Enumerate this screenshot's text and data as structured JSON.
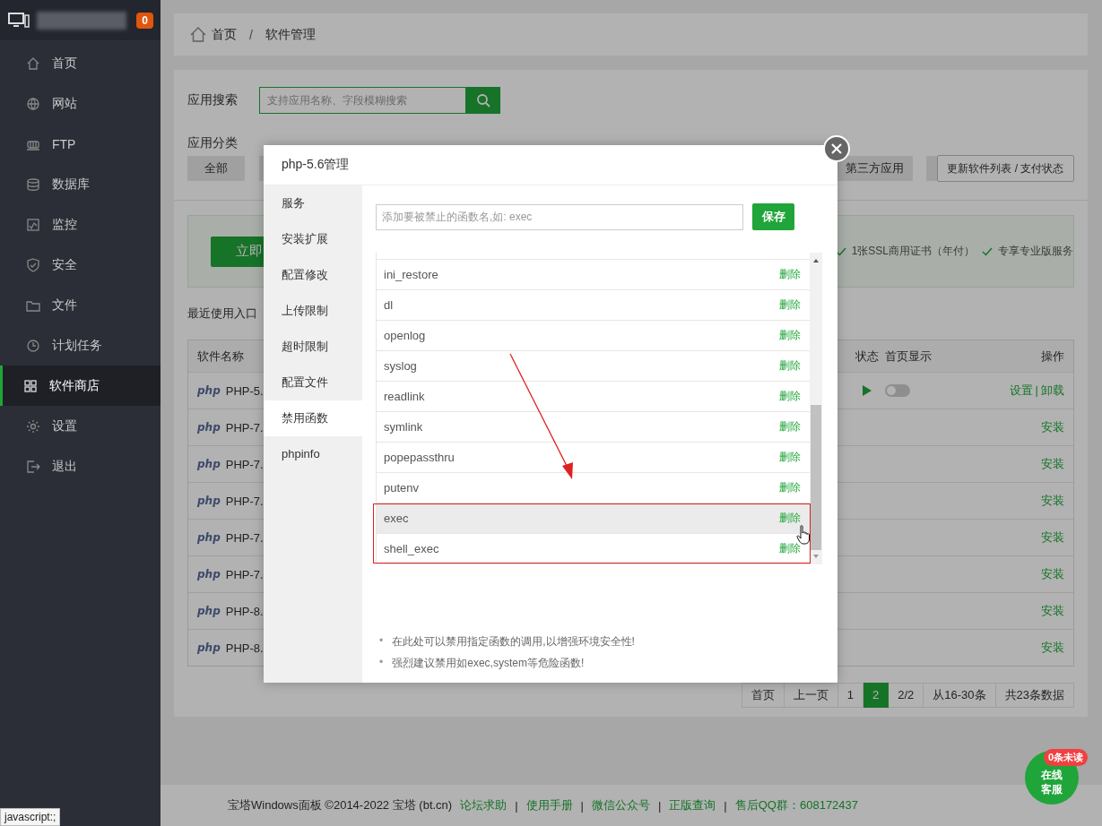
{
  "sidebar": {
    "badge": "0",
    "items": [
      {
        "label": "首页",
        "selected": false
      },
      {
        "label": "网站",
        "selected": false
      },
      {
        "label": "FTP",
        "selected": false
      },
      {
        "label": "数据库",
        "selected": false
      },
      {
        "label": "监控",
        "selected": false
      },
      {
        "label": "安全",
        "selected": false
      },
      {
        "label": "文件",
        "selected": false
      },
      {
        "label": "计划任务",
        "selected": false
      },
      {
        "label": "软件商店",
        "selected": true
      },
      {
        "label": "设置",
        "selected": false
      },
      {
        "label": "退出",
        "selected": false
      }
    ]
  },
  "breadcrumb": {
    "items": [
      "首页",
      "软件管理"
    ],
    "separator": "/"
  },
  "search": {
    "label": "应用搜索",
    "placeholder": "支持应用名称、字段模糊搜索"
  },
  "categories": {
    "label": "应用分类",
    "left": [
      {
        "kind": "labeled",
        "label": "全部"
      },
      {
        "kind": "blank"
      }
    ],
    "right": [
      {
        "kind": "labeled",
        "label": "第三方应用"
      },
      {
        "kind": "blank"
      }
    ]
  },
  "update_button": "更新软件列表 / 支付状态",
  "banner": {
    "button": "立即",
    "perks": [
      "1张SSL商用证书（年付）",
      "专享专业版服务"
    ]
  },
  "recent": "最近使用入口",
  "table": {
    "columns": [
      "软件名称",
      "状态",
      "首页显示",
      "操作"
    ],
    "action_separator": "|",
    "rows": [
      {
        "logo": "php",
        "name": "PHP-5.",
        "installed": true,
        "shown_on_home": false,
        "actions": [
          "设置",
          "卸载"
        ]
      },
      {
        "logo": "php",
        "name": "PHP-7.",
        "installed": false,
        "actions": [
          "安装"
        ]
      },
      {
        "logo": "php",
        "name": "PHP-7.",
        "installed": false,
        "actions": [
          "安装"
        ]
      },
      {
        "logo": "php",
        "name": "PHP-7.",
        "installed": false,
        "actions": [
          "安装"
        ]
      },
      {
        "logo": "php",
        "name": "PHP-7.",
        "installed": false,
        "actions": [
          "安装"
        ]
      },
      {
        "logo": "php",
        "name": "PHP-7.",
        "installed": false,
        "actions": [
          "安装"
        ]
      },
      {
        "logo": "php",
        "name": "PHP-8.",
        "installed": false,
        "actions": [
          "安装"
        ]
      },
      {
        "logo": "php",
        "name": "PHP-8.",
        "installed": false,
        "actions": [
          "安装"
        ]
      }
    ]
  },
  "pagination": [
    {
      "label": "首页",
      "selected": false
    },
    {
      "label": "上一页",
      "selected": false
    },
    {
      "label": "1",
      "selected": false
    },
    {
      "label": "2",
      "selected": true
    },
    {
      "label": "2/2",
      "selected": false
    },
    {
      "label": "从16-30条",
      "selected": false
    },
    {
      "label": "共23条数据",
      "selected": false
    }
  ],
  "footer": {
    "copyright": "宝塔Windows面板 ©2014-2022 宝塔 (bt.cn)",
    "separator": "|",
    "links": [
      "论坛求助",
      "使用手册",
      "微信公众号",
      "正版查询",
      "售后QQ群：608172437"
    ]
  },
  "chat": {
    "label": "在线客服",
    "badge": "0条未读"
  },
  "status_bar": "javascript:;",
  "modal": {
    "title": "php-5.6管理",
    "tabs": [
      {
        "label": "服务",
        "selected": false
      },
      {
        "label": "安装扩展",
        "selected": false
      },
      {
        "label": "配置修改",
        "selected": false
      },
      {
        "label": "上传限制",
        "selected": false
      },
      {
        "label": "超时限制",
        "selected": false
      },
      {
        "label": "配置文件",
        "selected": false
      },
      {
        "label": "禁用函数",
        "selected": true
      },
      {
        "label": "phpinfo",
        "selected": false
      }
    ],
    "input_placeholder": "添加要被禁止的函数名,如: exec",
    "save": "保存",
    "functions": [
      {
        "name": "ini_restore",
        "action": "删除",
        "hovered": false
      },
      {
        "name": "dl",
        "action": "删除",
        "hovered": false
      },
      {
        "name": "openlog",
        "action": "删除",
        "hovered": false
      },
      {
        "name": "syslog",
        "action": "删除",
        "hovered": false
      },
      {
        "name": "readlink",
        "action": "删除",
        "hovered": false
      },
      {
        "name": "symlink",
        "action": "删除",
        "hovered": false
      },
      {
        "name": "popepassthru",
        "action": "删除",
        "hovered": false
      },
      {
        "name": "putenv",
        "action": "删除",
        "hovered": false
      },
      {
        "name": "exec",
        "action": "删除",
        "hovered": true
      },
      {
        "name": "shell_exec",
        "action": "删除",
        "hovered": false
      }
    ],
    "bullet": "•",
    "notes": [
      "在此处可以禁用指定函数的调用,以增强环境安全性!",
      "强烈建议禁用如exec,system等危险函数!"
    ]
  }
}
